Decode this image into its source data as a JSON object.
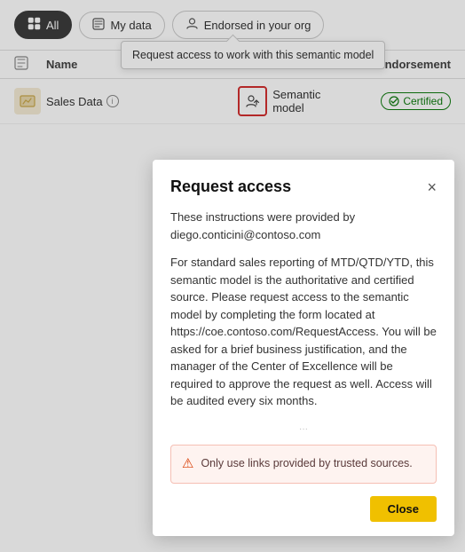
{
  "filterBar": {
    "allLabel": "All",
    "myDataLabel": "My data",
    "endorsedLabel": "Endorsed in your org"
  },
  "tooltip": {
    "text": "Request access to work with this semantic model"
  },
  "tableHeader": {
    "nameCol": "Name",
    "typeCol": "",
    "endorsementCol": "Endorsement"
  },
  "tableRow": {
    "name": "Sales Data",
    "type": "Semantic model",
    "endorsement": "Certified"
  },
  "modal": {
    "title": "Request access",
    "closeLabel": "×",
    "instructionLine": "These instructions were provided by diego.conticini@contoso.com",
    "bodyText": "For standard sales reporting of MTD/QTD/YTD, this semantic model is the authoritative and certified source. Please request access to the semantic model by completing the form located at https://coe.contoso.com/RequestAccess. You will be asked for a brief business justification, and the manager of the Center of Excellence will be required to approve the request as well. Access will be audited every six months.",
    "warningText": "Only use links provided by trusted sources.",
    "closeButtonLabel": "Close"
  },
  "icons": {
    "allIcon": "⊞",
    "myDataIcon": "🗂",
    "endorsedIcon": "👤",
    "rowIcon": "📊",
    "requestAccessIcon": "👥",
    "infoIcon": "i",
    "certifiedIcon": "✔",
    "warningTriangle": "⚠",
    "closeIcon": "✕"
  }
}
